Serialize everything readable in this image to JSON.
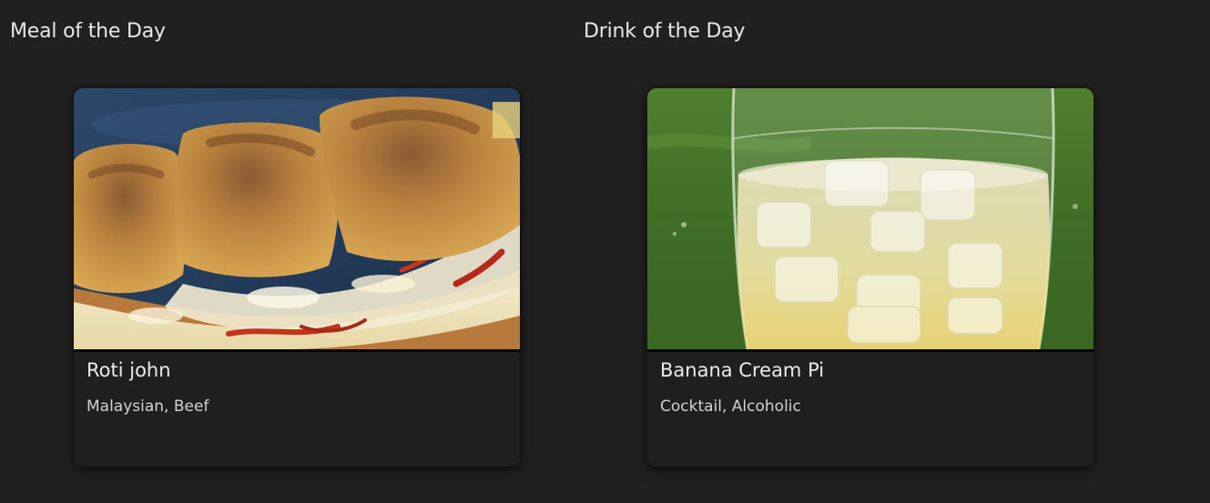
{
  "meal": {
    "heading": "Meal of the Day",
    "name": "Roti john",
    "tags": "Malaysian, Beef",
    "image_icon": "roti-john-photo"
  },
  "drink": {
    "heading": "Drink of the Day",
    "name": "Banana Cream Pi",
    "tags": "Cocktail, Alcoholic",
    "image_icon": "banana-cream-pi-photo"
  },
  "colors": {
    "background": "#202020",
    "card": "#1f1f1f",
    "text": "#e8e8e8",
    "subtext": "#d2d2d2"
  }
}
